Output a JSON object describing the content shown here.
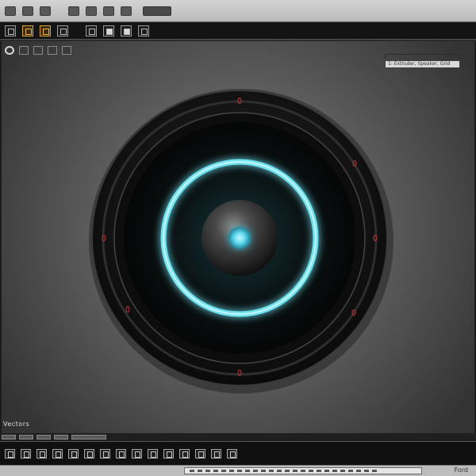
{
  "panel": {
    "text": "1: Extruder, Speaker, Grid"
  },
  "status": {
    "label": "Vectors"
  },
  "footer": {
    "label": "Ford"
  },
  "icons": {
    "titlebar": [
      "window-menu-icon",
      "file-icon",
      "edit-icon",
      "view-icon",
      "layer-icon",
      "sound-icon"
    ],
    "toolbar": [
      "new-icon",
      "open-icon",
      "save-icon",
      "undo-icon",
      "redo-icon",
      "frame-icon",
      "render-icon",
      "export-icon"
    ],
    "subbar": [
      "select-icon",
      "grid-icon",
      "move-icon",
      "scale-icon",
      "rotate-icon"
    ],
    "bottombar": [
      "rewind-icon",
      "step-back-icon",
      "play-icon",
      "pause-icon",
      "stop-icon",
      "step-forward-icon",
      "fast-forward-icon",
      "loop-icon",
      "record-icon",
      "keyframe-icon",
      "marker-icon",
      "camera-icon",
      "light-icon",
      "mesh-icon",
      "material-icon"
    ]
  },
  "colors": {
    "glow_ring": "#6fe3f2",
    "center_light": "#5fd8ef",
    "dial_body": "#121212",
    "screw_marks": "#a83232"
  }
}
